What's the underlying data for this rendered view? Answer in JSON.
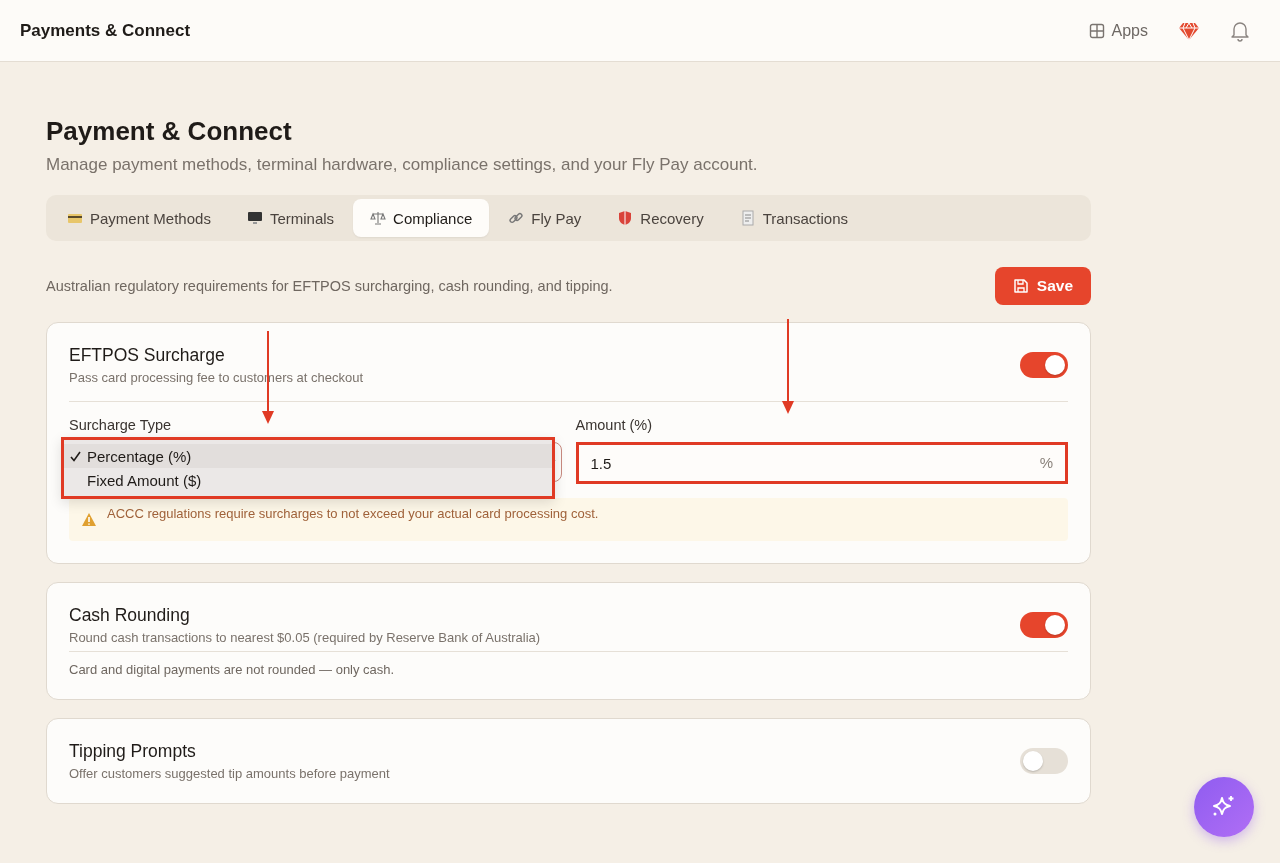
{
  "topbar": {
    "title": "Payments & Connect",
    "apps_label": "Apps"
  },
  "page": {
    "title": "Payment & Connect",
    "subtitle": "Manage payment methods, terminal hardware, compliance settings, and your Fly Pay account."
  },
  "tabs": [
    {
      "label": "Payment Methods",
      "kind": "card",
      "selected": false
    },
    {
      "label": "Terminals",
      "kind": "monitor",
      "selected": false
    },
    {
      "label": "Compliance",
      "kind": "scales",
      "selected": true
    },
    {
      "label": "Fly Pay",
      "kind": "link",
      "selected": false
    },
    {
      "label": "Recovery",
      "kind": "shield",
      "selected": false
    },
    {
      "label": "Transactions",
      "kind": "receipt",
      "selected": false
    }
  ],
  "section": {
    "description": "Australian regulatory requirements for EFTPOS surcharging, cash rounding, and tipping.",
    "save_label": "Save"
  },
  "surcharge": {
    "title": "EFTPOS Surcharge",
    "description": "Pass card processing fee to customers at checkout",
    "on": true,
    "type_label": "Surcharge Type",
    "type_options": [
      {
        "label": "Percentage (%)",
        "selected": true
      },
      {
        "label": "Fixed Amount ($)",
        "selected": false
      }
    ],
    "amount_label": "Amount (%)",
    "amount_value": "1.5",
    "amount_suffix": "%",
    "warning": "ACCC regulations require surcharges to not exceed your actual card processing cost."
  },
  "cash_rounding": {
    "title": "Cash Rounding",
    "description": "Round cash transactions to nearest $0.05 (required by Reserve Bank of Australia)",
    "on": true,
    "note": "Card and digital payments are not rounded — only cash."
  },
  "tipping": {
    "title": "Tipping Prompts",
    "description": "Offer customers suggested tip amounts before payment",
    "on": false
  }
}
